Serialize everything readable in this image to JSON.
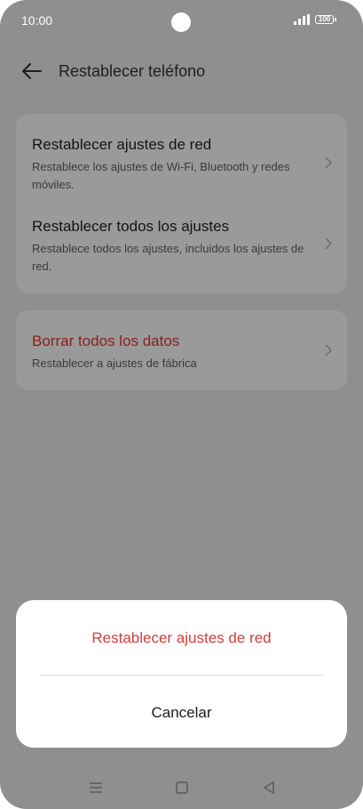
{
  "status_bar": {
    "time": "10:00",
    "battery": "100"
  },
  "header": {
    "title": "Restablecer teléfono"
  },
  "options": [
    {
      "title": "Restablecer ajustes de red",
      "subtitle": "Restablece los ajustes de Wi-Fi, Bluetooth y redes móviles."
    },
    {
      "title": "Restablecer todos los ajustes",
      "subtitle": "Restablece todos los ajustes, incluidos los ajustes de red."
    }
  ],
  "factory_reset": {
    "title": "Borrar todos los datos",
    "subtitle": "Restablecer a ajustes de fábrica"
  },
  "dialog": {
    "confirm_label": "Restablecer ajustes de red",
    "cancel_label": "Cancelar"
  },
  "colors": {
    "danger": "#d83b3b",
    "scrim": "#8f8f8f"
  }
}
